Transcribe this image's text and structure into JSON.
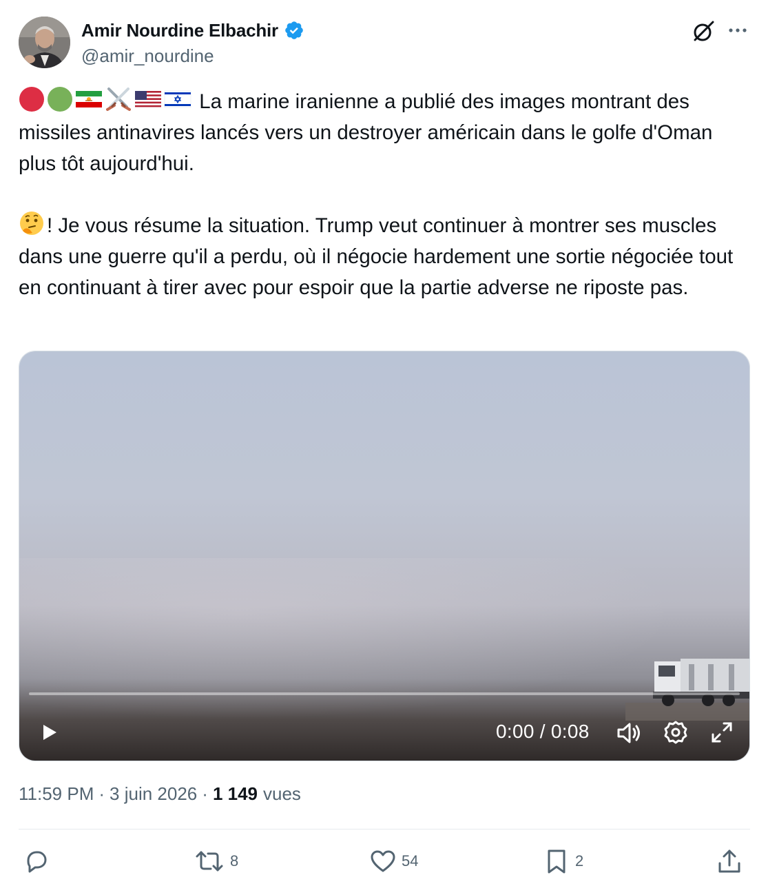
{
  "author": {
    "display_name": "Amir Nourdine Elbachir",
    "handle": "@amir_nourdine",
    "verified": true,
    "avatar_icon": "avatar-photo"
  },
  "header_icons": [
    "grok-icon",
    "more-icon"
  ],
  "tweet": {
    "emojis": [
      "red-circle",
      "green-circle",
      "iran-lion-sun-flag",
      "crossed-swords",
      "us-flag",
      "israel-flag",
      "thinking-face"
    ],
    "paragraph1": "La marine iranienne a publié des images montrant des missiles antinavires lancés vers un destroyer américain dans le golfe d'Oman plus tôt aujourd'hui.",
    "paragraph2": "! Je vous résume la situation. Trump veut continuer à montrer ses muscles dans une guerre qu'il a perdu, où il négocie hardement une sortie négociée tout en continuant à tirer avec pour espoir que la partie adverse ne riposte pas."
  },
  "video": {
    "time_display": "0:00 / 0:08",
    "progress_fraction": 0.0,
    "controls": [
      "play-icon",
      "volume-icon",
      "settings-icon",
      "fullscreen-icon"
    ]
  },
  "meta": {
    "time": "11:59 PM",
    "dot": "·",
    "date": "3 juin 2026",
    "views_count": "1 149",
    "views_label": "vues"
  },
  "actions": {
    "reply_count": "",
    "retweet_count": "8",
    "like_count": "54",
    "bookmark_count": "2"
  },
  "colors": {
    "text_primary": "#0f1419",
    "text_secondary": "#536471",
    "verified_blue": "#1d9bf0",
    "divider": "#e6ebef"
  }
}
